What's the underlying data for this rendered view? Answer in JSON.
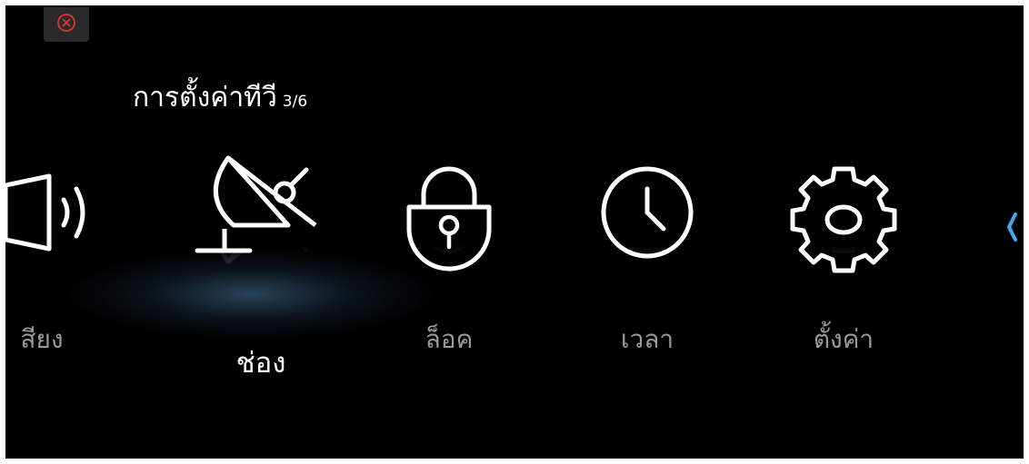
{
  "title": {
    "text": "การตั้งค่าทีวี",
    "page": "3/6"
  },
  "menu": {
    "items": [
      {
        "label": "สียง",
        "icon": "speaker-icon",
        "selected": false
      },
      {
        "label": "ช่อง",
        "icon": "satellite-dish-icon",
        "selected": true
      },
      {
        "label": "ล็อค",
        "icon": "padlock-icon",
        "selected": false
      },
      {
        "label": "เวลา",
        "icon": "clock-icon",
        "selected": false
      },
      {
        "label": "ตั้งค่า",
        "icon": "gear-icon",
        "selected": false
      }
    ]
  },
  "colors": {
    "background": "#000000",
    "text": "#ffffff",
    "dim_text": "#9a9a9a",
    "close": "#e0332f",
    "arrow": "#4aa8e8"
  },
  "icons": {
    "close": "close-icon",
    "nav_arrow": "chevron-left-icon"
  }
}
